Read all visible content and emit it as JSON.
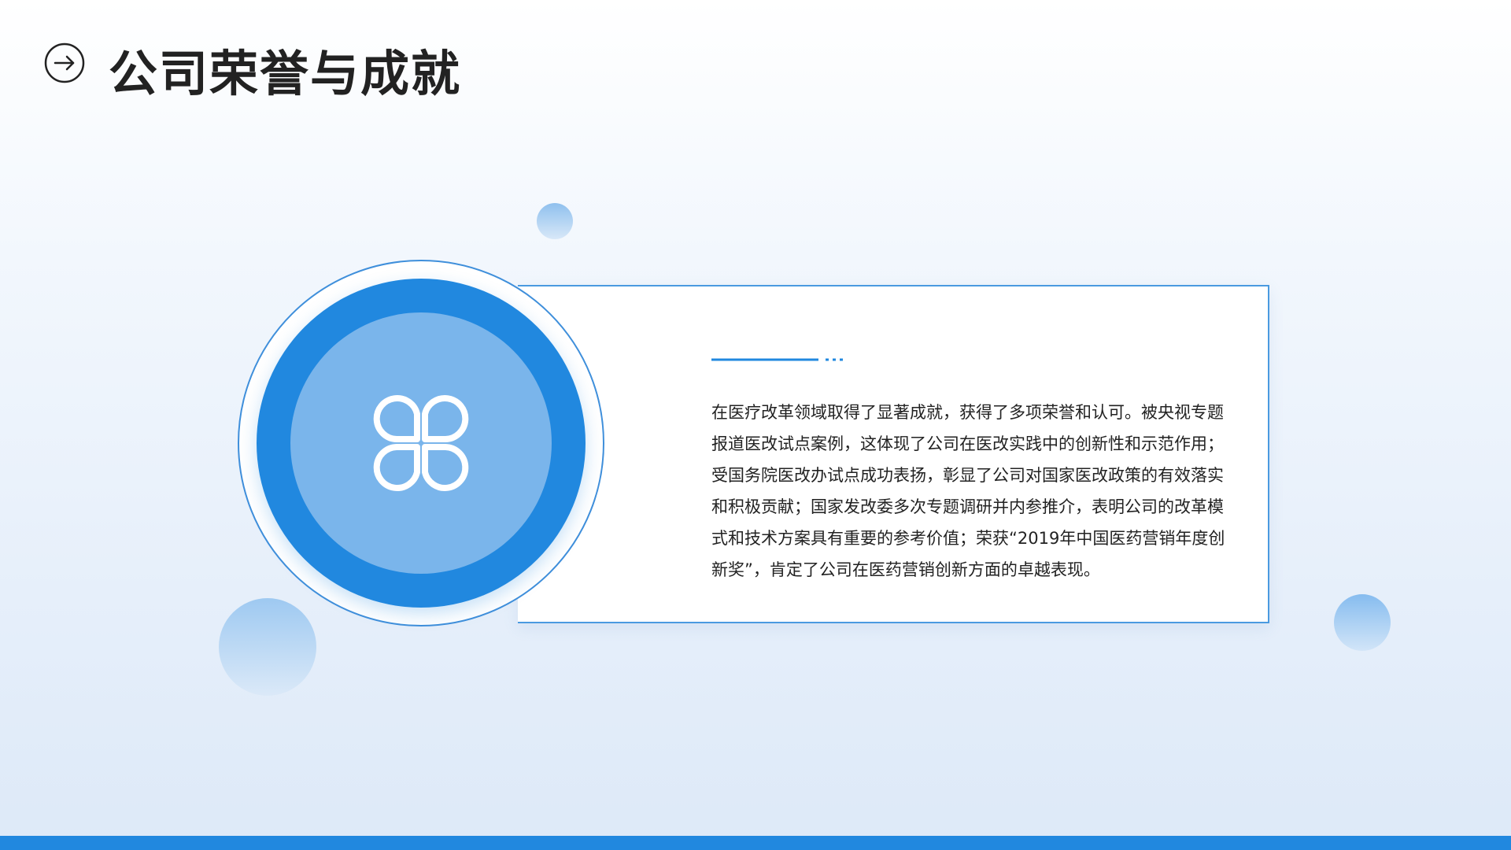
{
  "header": {
    "icon": "arrow-right-circle-icon",
    "title": "公司荣誉与成就"
  },
  "card": {
    "body": "在医疗改革领域取得了显著成就，获得了多项荣誉和认可。被央视专题报道医改试点案例，这体现了公司在医改实践中的创新性和示范作用；受国务院医改办试点成功表扬，彰显了公司对国家医改政策的有效落实和积极贡献；国家发改委多次专题调研并内参推介，表明公司的改革模式和技术方案具有重要的参考价值；荣获“2019年中国医药营销年度创新奖”，肯定了公司在医药营销创新方面的卓越表现。"
  },
  "medallion": {
    "icon": "clover-icon"
  },
  "colors": {
    "accent": "#2188df",
    "accent_light": "#7ab5eb",
    "title": "#222222",
    "text": "#222222",
    "background_bottom": "#dde9f8"
  }
}
